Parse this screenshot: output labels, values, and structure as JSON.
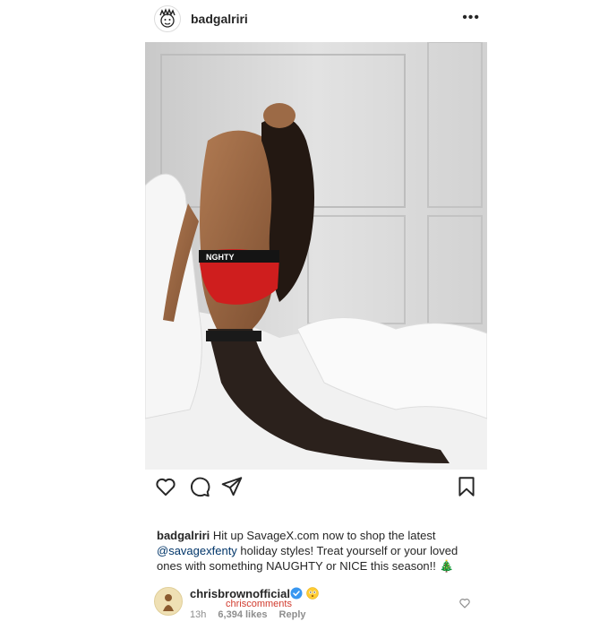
{
  "post": {
    "username": "badgalriri",
    "more_label": "•••"
  },
  "photo": {
    "waistband_text": "NGHTY"
  },
  "caption": {
    "username": "badgalriri",
    "text_before": " Hit up SavageX.com now to shop the latest ",
    "mention": "@savagexfenty",
    "text_after": " holiday styles! Treat yourself or your loved ones with something NAUGHTY or NICE this season!! 🎄"
  },
  "comment": {
    "username": "chrisbrownofficial",
    "text": "chriscomments",
    "time": "13h",
    "likes": "6,394 likes",
    "reply": "Reply"
  },
  "icons": {
    "like": "heart-icon",
    "comment": "comment-icon",
    "share": "share-icon",
    "save": "bookmark-icon",
    "verified": "verified-badge-icon",
    "emoji": "flushed-face-icon"
  },
  "colors": {
    "accent_red": "#d13b2e",
    "mention_blue": "#003569",
    "verified_blue": "#3897f0"
  }
}
